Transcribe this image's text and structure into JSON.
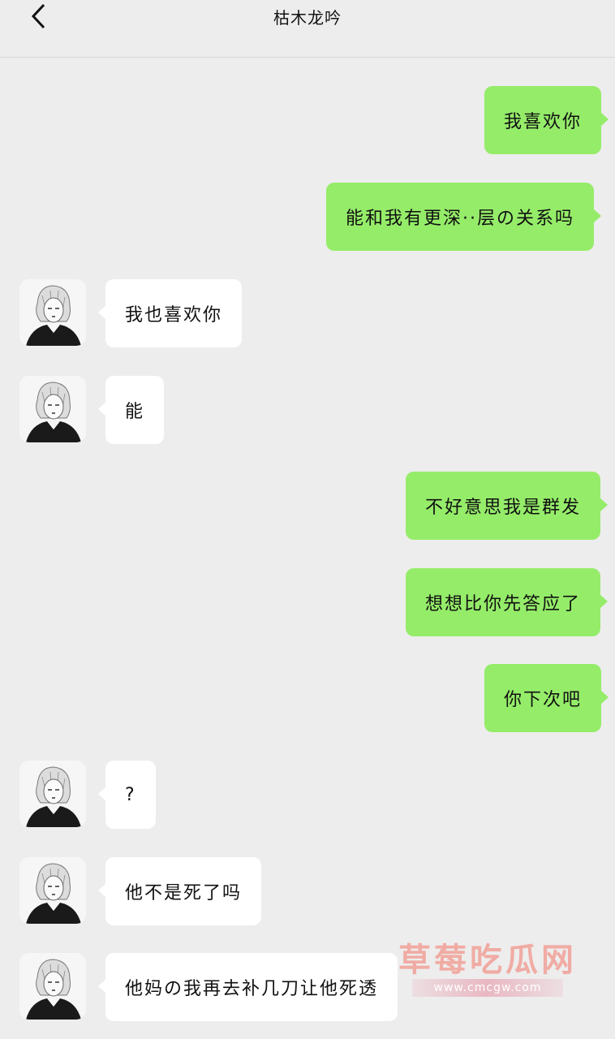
{
  "header": {
    "title": "枯木龙吟",
    "back_icon": "chevron-left-icon"
  },
  "messages": [
    {
      "dir": "out",
      "text": "我喜欢你"
    },
    {
      "dir": "out",
      "text": "能和我有更深··层の关系吗"
    },
    {
      "dir": "in",
      "text": "我也喜欢你"
    },
    {
      "dir": "in",
      "text": "能"
    },
    {
      "dir": "out",
      "text": "不好意思我是群发"
    },
    {
      "dir": "out",
      "text": "想想比你先答应了"
    },
    {
      "dir": "out",
      "text": "你下次吧"
    },
    {
      "dir": "in",
      "text": "?"
    },
    {
      "dir": "in",
      "text": "他不是死了吗"
    },
    {
      "dir": "in",
      "text": "他妈の我再去补几刀让他死透"
    }
  ],
  "watermark": {
    "text": "草莓吃瓜网",
    "url": "www.cmcgw.com"
  },
  "colors": {
    "background": "#ededed",
    "outgoing": "#95ec69",
    "incoming": "#ffffff"
  }
}
